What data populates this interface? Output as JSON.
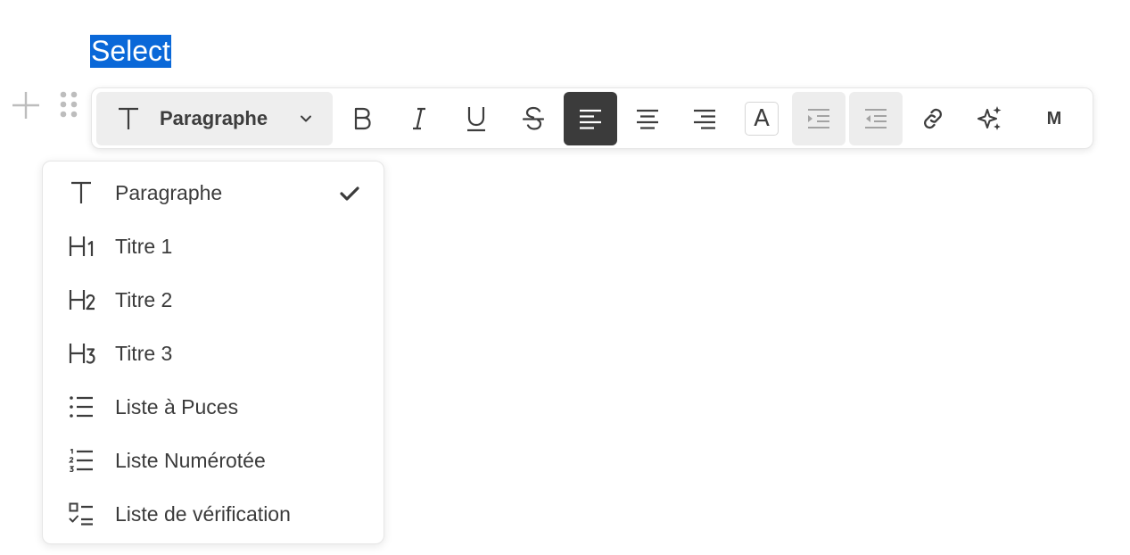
{
  "editor": {
    "selected_text": "Select"
  },
  "toolbar": {
    "block_type": {
      "icon": "text-t-icon",
      "label": "Paragraphe",
      "chevron": "chevron-down-icon"
    },
    "buttons": [
      {
        "name": "bold",
        "icon": "bold-icon",
        "state": "normal"
      },
      {
        "name": "italic",
        "icon": "italic-icon",
        "state": "normal"
      },
      {
        "name": "underline",
        "icon": "underline-icon",
        "state": "normal"
      },
      {
        "name": "strikethrough",
        "icon": "strikethrough-icon",
        "state": "normal"
      },
      {
        "name": "align-left",
        "icon": "align-left-icon",
        "state": "active"
      },
      {
        "name": "align-center",
        "icon": "align-center-icon",
        "state": "normal"
      },
      {
        "name": "align-right",
        "icon": "align-right-icon",
        "state": "normal"
      },
      {
        "name": "text-color",
        "icon": "text-color-icon",
        "state": "normal",
        "glyph": "A"
      },
      {
        "name": "indent",
        "icon": "indent-icon",
        "state": "disabled"
      },
      {
        "name": "outdent",
        "icon": "outdent-icon",
        "state": "disabled"
      },
      {
        "name": "link",
        "icon": "link-icon",
        "state": "normal"
      },
      {
        "name": "ai",
        "icon": "sparkles-icon",
        "state": "normal"
      },
      {
        "name": "markdown",
        "icon": "markdown-icon",
        "state": "normal",
        "glyph": "M"
      }
    ]
  },
  "dropdown": {
    "items": [
      {
        "label": "Paragraphe",
        "icon": "text-t-icon",
        "selected": true
      },
      {
        "label": "Titre 1",
        "icon": "heading-1-icon",
        "selected": false
      },
      {
        "label": "Titre 2",
        "icon": "heading-2-icon",
        "selected": false
      },
      {
        "label": "Titre 3",
        "icon": "heading-3-icon",
        "selected": false
      },
      {
        "label": "Liste à Puces",
        "icon": "bullet-list-icon",
        "selected": false
      },
      {
        "label": "Liste Numérotée",
        "icon": "numbered-list-icon",
        "selected": false
      },
      {
        "label": "Liste de vérification",
        "icon": "checklist-icon",
        "selected": false
      }
    ]
  },
  "colors": {
    "selection": "#0a68d8",
    "active_button": "#3b3b3b",
    "disabled_button": "#ededed",
    "text": "#3b3b3b"
  }
}
